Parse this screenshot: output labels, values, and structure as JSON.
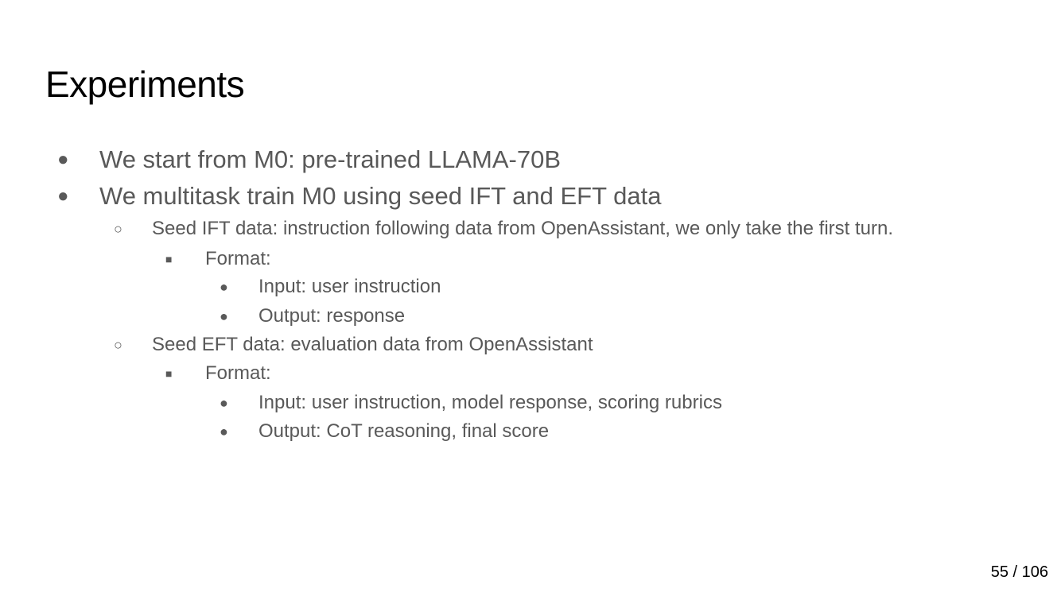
{
  "slide": {
    "title": "Experiments",
    "bullets": [
      {
        "marker": "●",
        "text": "We start from M0: pre-trained LLAMA-70B"
      },
      {
        "marker": "●",
        "text": "We multitask train M0 using seed IFT and EFT data"
      },
      {
        "marker": "○",
        "text": "Seed IFT data: instruction following data from OpenAssistant, we only take the first turn."
      },
      {
        "marker": "■",
        "text": "Format:"
      },
      {
        "marker": "●",
        "text": "Input: user instruction"
      },
      {
        "marker": "●",
        "text": "Output: response"
      },
      {
        "marker": "○",
        "text": "Seed EFT data: evaluation data from OpenAssistant"
      },
      {
        "marker": "■",
        "text": "Format:"
      },
      {
        "marker": "●",
        "text": "Input: user instruction, model response, scoring rubrics"
      },
      {
        "marker": "●",
        "text": "Output: CoT reasoning, final score"
      }
    ],
    "page_number": "55 / 106"
  }
}
